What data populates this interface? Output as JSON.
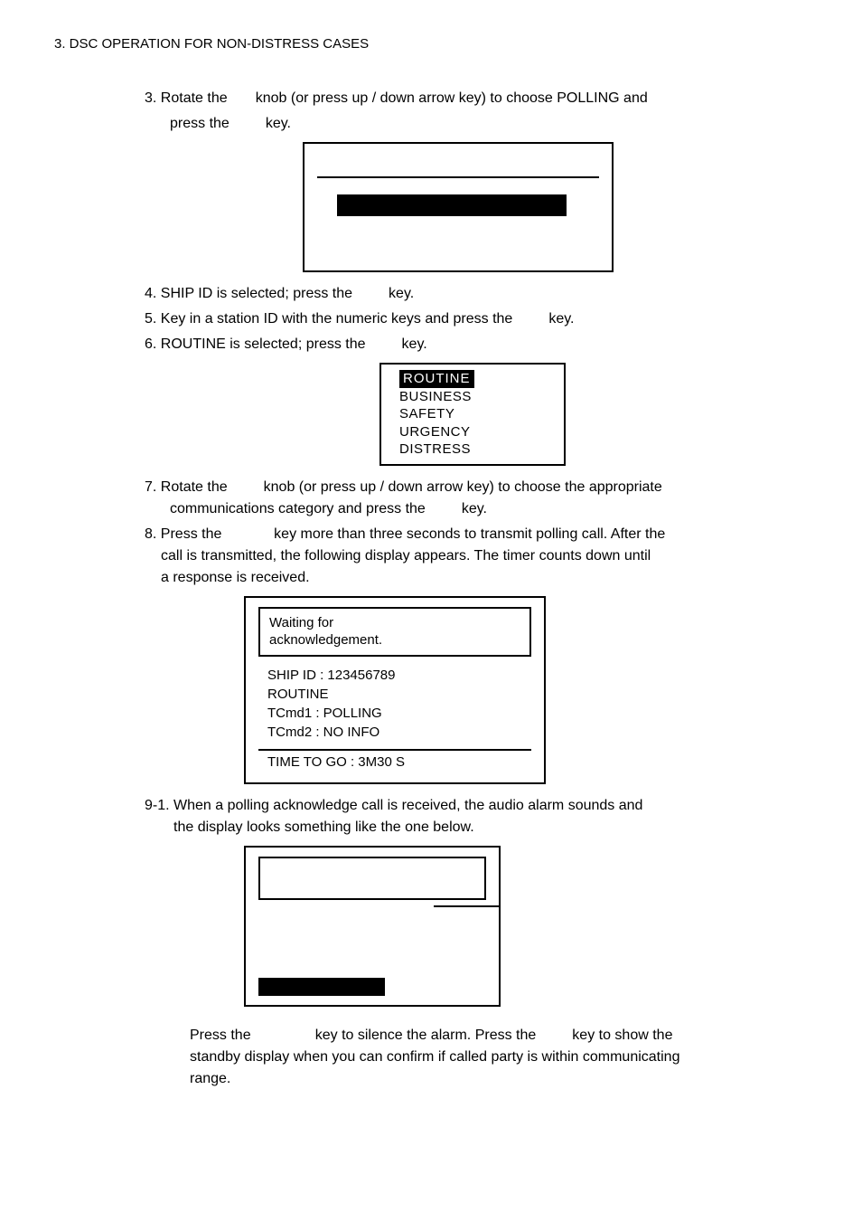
{
  "header": "3. DSC OPERATION FOR NON-DISTRESS CASES",
  "step3a": "3. Rotate the",
  "step3b": "knob (or press up / down arrow key) to choose POLLING and",
  "step3c": "press the",
  "step3d": "key.",
  "step4a": "4. SHIP ID is selected; press the",
  "step4b": "key.",
  "step5a": "5. Key in a station ID with the numeric keys and press the",
  "step5b": "key.",
  "step6a": "6. ROUTINE is selected; press the",
  "step6b": "key.",
  "menu": {
    "routine": "ROUTINE",
    "business": "BUSINESS",
    "safety": "SAFETY",
    "urgency": "URGENCY",
    "distress": "DISTRESS"
  },
  "step7a": "7. Rotate the",
  "step7b": "knob (or press up / down arrow key) to choose the appropriate",
  "step7c": "communications category and press the",
  "step7d": "key.",
  "step8a": "8. Press the",
  "step8b": "key more than three seconds to transmit polling call. After the",
  "step8c": "call is transmitted, the following display appears. The timer counts down until",
  "step8d": "a response is received.",
  "waitbox": {
    "l1": "Waiting for",
    "l2": "acknowledgement.",
    "ship": "SHIP ID : 123456789",
    "routine": "ROUTINE",
    "tc1": "TCmd1 : POLLING",
    "tc2": "TCmd2 : NO INFO",
    "time": "TIME TO GO : 3M30 S"
  },
  "step91a": "9-1. When a polling acknowledge call is received, the audio alarm sounds and",
  "step91b": "the display looks something like the one below.",
  "finala": "Press the",
  "finalb": "key to silence the alarm. Press the",
  "finalc": "key to show the",
  "finald": "standby display when you can confirm if called party is within communicating",
  "finale": "range."
}
